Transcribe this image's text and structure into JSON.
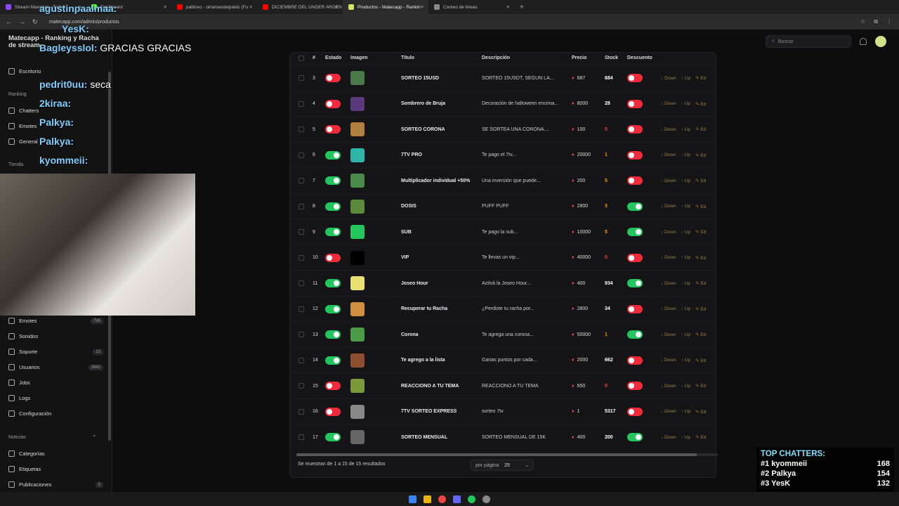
{
  "browser": {
    "tabs": [
      {
        "label": "Stream Manager - Twitch",
        "color": "#9146ff"
      },
      {
        "label": "Dashboard",
        "color": "#53fc18"
      },
      {
        "label": "pabloxo - otramasdelpablo (Fu",
        "color": "#ff0000"
      },
      {
        "label": "DICIEMBRE DEL UNDER ARGEN",
        "color": "#ff0000"
      },
      {
        "label": "Productos - Matecapp - Rankin",
        "color": "#d8e36a",
        "active": true
      },
      {
        "label": "Conteo de lineas",
        "color": "#888888"
      }
    ],
    "url": "matecapp.com/admin/productos"
  },
  "sidebar": {
    "brand": "Matecapp - Ranking y Racha de stream",
    "items_top": [
      {
        "label": "Escritorio"
      },
      {
        "label": "Chatters"
      },
      {
        "label": "Emotes"
      },
      {
        "label": "General"
      }
    ],
    "section_ranking": "Ranking",
    "section_tienda": "Tienda",
    "items": [
      {
        "label": "Emotes",
        "badge": "795"
      },
      {
        "label": "Sonidos",
        "badge": ""
      },
      {
        "label": "Soporte",
        "badge": "13"
      },
      {
        "label": "Usuarios",
        "badge": "2642"
      },
      {
        "label": "Jobs",
        "badge": ""
      },
      {
        "label": "Logs",
        "badge": ""
      },
      {
        "label": "Configuración",
        "badge": ""
      }
    ],
    "section_noticias": "Noticias",
    "noticias": [
      {
        "label": "Categorías",
        "badge": ""
      },
      {
        "label": "Etiquetas",
        "badge": ""
      },
      {
        "label": "Publicaciones",
        "badge": "3"
      }
    ]
  },
  "chat_overlay": [
    {
      "user": "agustinpaalmaa:",
      "text": ""
    },
    {
      "user": "YesK:",
      "text": ""
    },
    {
      "user": "Bagleysslol:",
      "text": "GRACIAS  GRACIAS"
    },
    {
      "user": "pedrit0uu:",
      "text": "seca"
    },
    {
      "user": "2kiraa:",
      "text": ""
    },
    {
      "user": "Palkya:",
      "text": ""
    },
    {
      "user": "Palkya:",
      "text": ""
    },
    {
      "user": "kyommeii:",
      "text": ""
    }
  ],
  "search": {
    "placeholder": "Buscar"
  },
  "table": {
    "headers": [
      "#",
      "Estado",
      "Imagen",
      "Título",
      "Descripción",
      "Precio",
      "Stock",
      "Descuento"
    ],
    "actions": {
      "down": "Down",
      "up": "Up",
      "edit": "Ed"
    },
    "rows": [
      {
        "id": "3",
        "estado": false,
        "title": "SORTEO 15USD",
        "desc": "SORTEO 15USDT, SEGUN LA...",
        "price": "687",
        "stock": "684",
        "stock_color": "#ffffff",
        "desc_on": false,
        "img": "#4a7a4a"
      },
      {
        "id": "4",
        "estado": false,
        "title": "Sombrero de Bruja",
        "desc": "Decoración de halloween encima...",
        "price": "8000",
        "stock": "28",
        "stock_color": "#ffffff",
        "desc_on": false,
        "img": "#5a3a7a"
      },
      {
        "id": "5",
        "estado": false,
        "title": "SORTEO CORONA",
        "desc": "SE SORTEA UNA CORONA....",
        "price": "100",
        "stock": "0",
        "stock_color": "#ef4444",
        "desc_on": false,
        "img": "#b08040"
      },
      {
        "id": "6",
        "estado": true,
        "title": "7TV PRO",
        "desc": "Te pago el 7tv...",
        "price": "20000",
        "stock": "1",
        "stock_color": "#f59e0b",
        "desc_on": false,
        "img": "#2fb5a8"
      },
      {
        "id": "7",
        "estado": true,
        "title": "Multiplicador individual +50%",
        "desc": "Una inversión que puede...",
        "price": "200",
        "stock": "5",
        "stock_color": "#f59e0b",
        "desc_on": false,
        "img": "#4a8a4a"
      },
      {
        "id": "8",
        "estado": true,
        "title": "DOSIS",
        "desc": "PUFF PUFF",
        "price": "2800",
        "stock": "3",
        "stock_color": "#f59e0b",
        "desc_on": true,
        "img": "#5a8a3a"
      },
      {
        "id": "9",
        "estado": true,
        "title": "SUB",
        "desc": "Te pago la sub...",
        "price": "10000",
        "stock": "5",
        "stock_color": "#f59e0b",
        "desc_on": true,
        "img": "#22c55e"
      },
      {
        "id": "10",
        "estado": false,
        "title": "VIP",
        "desc": "Te llevas un vip...",
        "price": "40000",
        "stock": "0",
        "stock_color": "#ef4444",
        "desc_on": false,
        "img": "#000000"
      },
      {
        "id": "11",
        "estado": true,
        "title": "Joseo Hour",
        "desc": "Activá la Joseo Hour...",
        "price": "400",
        "stock": "934",
        "stock_color": "#ffffff",
        "desc_on": true,
        "img": "#e8e070"
      },
      {
        "id": "12",
        "estado": true,
        "title": "Recuperar tu Racha",
        "desc": "¿Perdiste tu racha por...",
        "price": "2800",
        "stock": "34",
        "stock_color": "#ffffff",
        "desc_on": false,
        "img": "#d09040"
      },
      {
        "id": "13",
        "estado": true,
        "title": "Corona",
        "desc": "Te agrega una corona...",
        "price": "50000",
        "stock": "1",
        "stock_color": "#f59e0b",
        "desc_on": true,
        "img": "#4a9a4a"
      },
      {
        "id": "14",
        "estado": true,
        "title": "Te agrego a la lista",
        "desc": "Ganas puntos por cada...",
        "price": "2000",
        "stock": "662",
        "stock_color": "#ffffff",
        "desc_on": false,
        "img": "#8a5030"
      },
      {
        "id": "15",
        "estado": false,
        "title": "REACCIONO A TU TEMA",
        "desc": "REACCIONO A TU TEMA",
        "price": "650",
        "stock": "0",
        "stock_color": "#ef4444",
        "desc_on": false,
        "img": "#7a9a3a"
      },
      {
        "id": "16",
        "estado": false,
        "title": "7TV SORTEO EXPRESS",
        "desc": "sorteo 7tv",
        "price": "1",
        "stock": "5317",
        "stock_color": "#ffffff",
        "desc_on": false,
        "img": "#888888"
      },
      {
        "id": "17",
        "estado": true,
        "title": "SORTEO MENSUAL",
        "desc": "SORTEO MENSUAL DE 15K",
        "price": "400",
        "stock": "200",
        "stock_color": "#ffffff",
        "desc_on": true,
        "img": "#666666"
      }
    ]
  },
  "footer": {
    "results": "Se muestran de 1 a 15 de 15 resultados",
    "per_page_label": "por página",
    "per_page_value": "25"
  },
  "top_chatters": {
    "title": "TOP CHATTERS:",
    "list": [
      {
        "rank": "#1",
        "name": "kyommeii",
        "count": "168"
      },
      {
        "rank": "#2",
        "name": "Palkya",
        "count": "154"
      },
      {
        "rank": "#3",
        "name": "YesK",
        "count": "132"
      }
    ]
  }
}
